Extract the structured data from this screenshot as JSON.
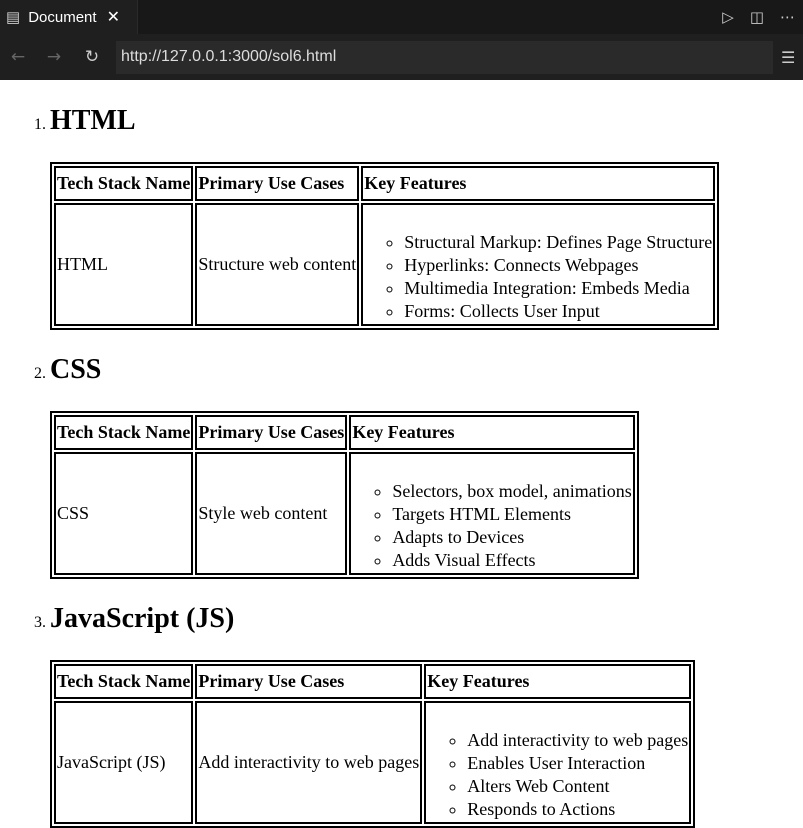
{
  "tab": {
    "title": "Document",
    "icon": "preview-icon"
  },
  "address": {
    "url": "http://127.0.0.1:3000/sol6.html"
  },
  "headers": [
    "Tech Stack Name",
    "Primary Use Cases",
    "Key Features"
  ],
  "sections": [
    {
      "number": "1.",
      "title": "HTML",
      "name": "HTML",
      "use": "Structure web content",
      "features": [
        "Structural Markup: Defines Page Structure",
        "Hyperlinks: Connects Webpages",
        "Multimedia Integration: Embeds Media",
        "Forms: Collects User Input"
      ]
    },
    {
      "number": "2.",
      "title": "CSS",
      "name": "CSS",
      "use": "Style web content",
      "features": [
        "Selectors, box model, animations",
        "Targets HTML Elements",
        "Adapts to Devices",
        "Adds Visual Effects"
      ]
    },
    {
      "number": "3.",
      "title": "JavaScript (JS)",
      "name": "JavaScript (JS)",
      "use": "Add interactivity to web pages",
      "features": [
        "Add interactivity to web pages",
        "Enables User Interaction",
        "Alters Web Content",
        "Responds to Actions"
      ]
    }
  ]
}
